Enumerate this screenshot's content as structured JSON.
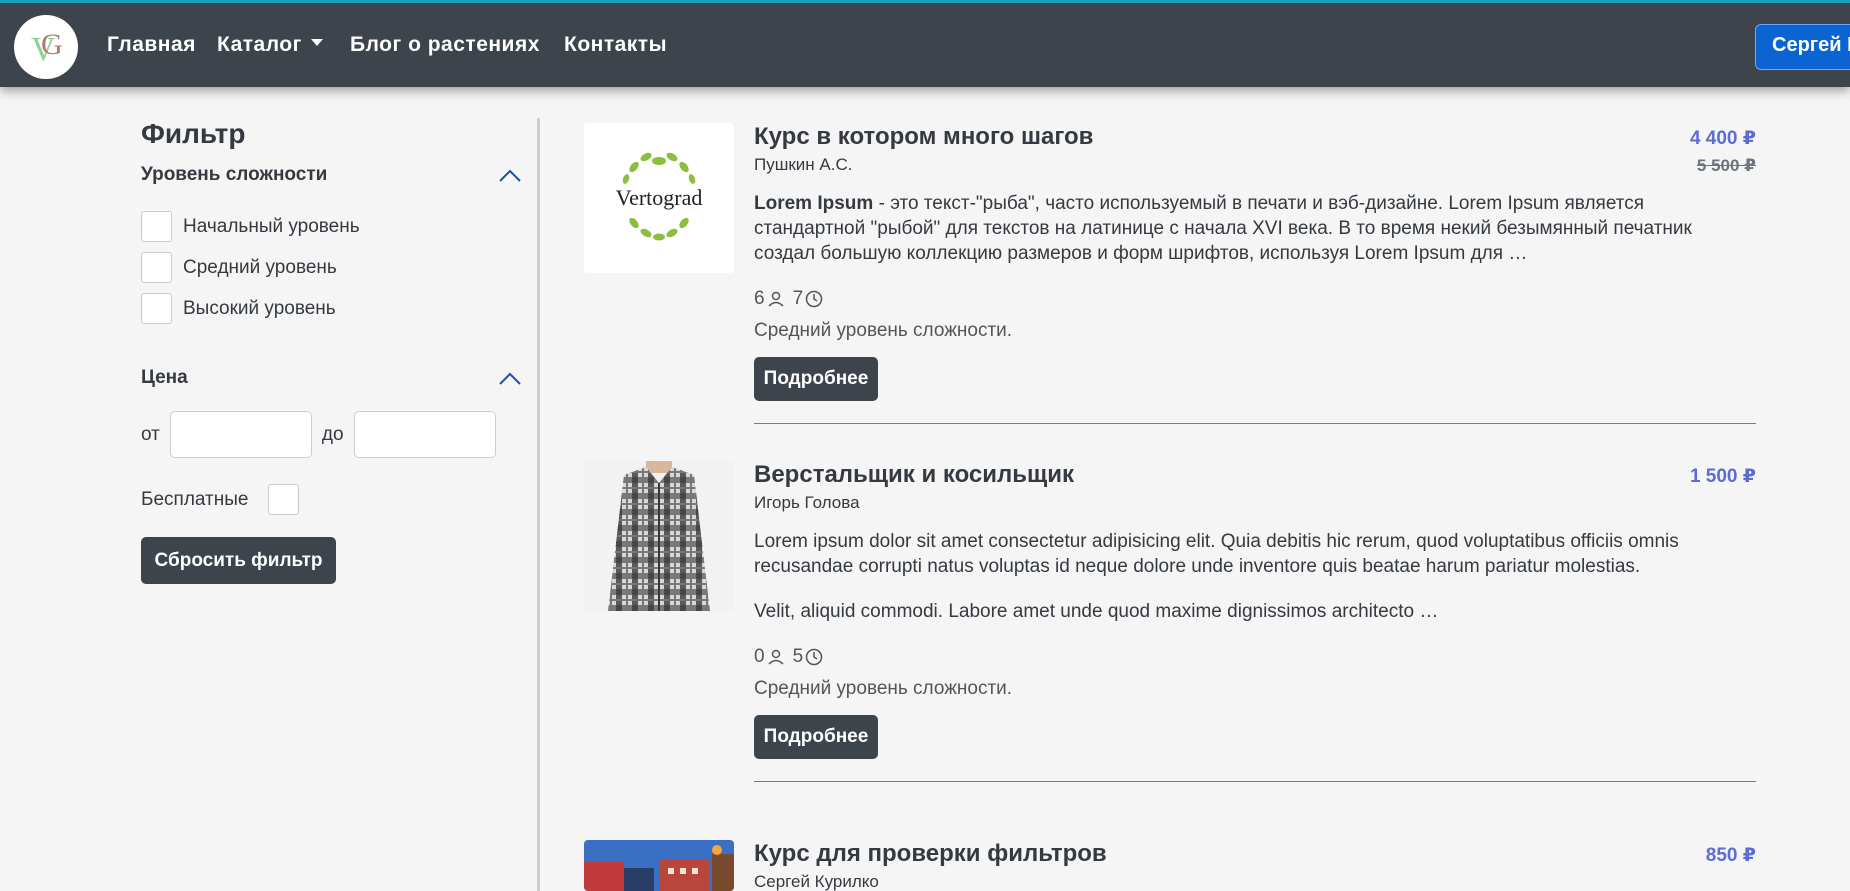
{
  "nav": {
    "items": [
      "Главная",
      "Каталог",
      "Блог о растениях",
      "Контакты"
    ],
    "user_label": "Сергей К"
  },
  "filter": {
    "title": "Фильтр",
    "difficulty": {
      "label": "Уровень сложности",
      "options": [
        "Начальный уровень",
        "Средний уровень",
        "Высокий уровень"
      ]
    },
    "price": {
      "label": "Цена",
      "from_label": "от",
      "to_label": "до",
      "free_label": "Бесплатные"
    },
    "reset_label": "Сбросить фильтр"
  },
  "courses": [
    {
      "title": "Курс в котором много шагов",
      "author": "Пушкин А.С.",
      "price": "4 400 ₽",
      "old_price": "5 500 ₽",
      "desc_bold": "Lorem Ipsum",
      "desc": " - это текст-\"рыба\", часто используемый в печати и вэб-дизайне. Lorem Ipsum является стандартной \"рыбой\" для текстов на латинице с начала XVI века. В то время некий безымянный печатник создал большую коллекцию размеров и форм шрифтов, используя Lorem Ipsum для …",
      "students": "6",
      "hours": "7",
      "level": "Средний уровень сложности.",
      "button": "Подробнее",
      "thumb_text": "Vertograd"
    },
    {
      "title": "Верстальщик и косильщик",
      "author": "Игорь Голова",
      "price": "1 500 ₽",
      "desc": "Lorem ipsum dolor sit amet consectetur adipisicing elit. Quia debitis hic rerum, quod voluptatibus officiis omnis recusandae corrupti natus voluptas id neque dolore unde inventore quis beatae harum pariatur molestias.",
      "desc2": "Velit, aliquid commodi. Labore amet unde quod maxime dignissimos architecto …",
      "students": "0",
      "hours": "5",
      "level": "Средний уровень сложности.",
      "button": "Подробнее"
    },
    {
      "title": "Курс для проверки фильтров",
      "author": "Сергей Курилко",
      "price": "850 ₽"
    }
  ],
  "colors": {
    "navbar": "#3d444c",
    "accent_line": "#17a2b8",
    "price": "#5c6bd6",
    "user_button": "#0b64d2"
  }
}
